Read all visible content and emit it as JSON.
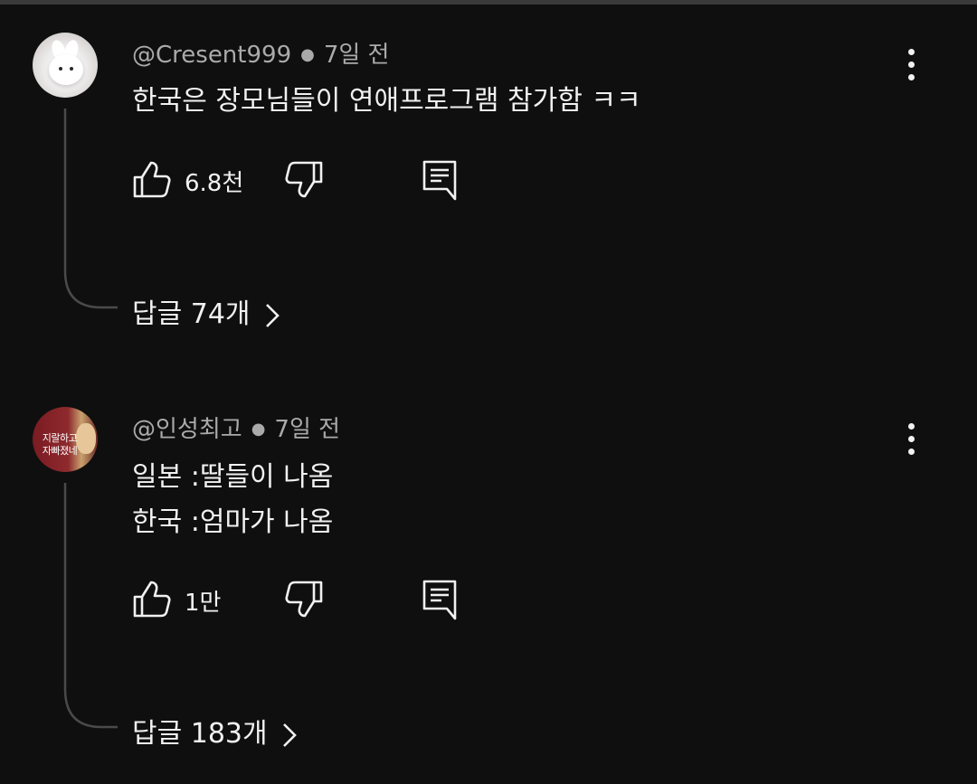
{
  "comments": [
    {
      "author": "@Cresent999",
      "time": "7일 전",
      "text_lines": [
        "한국은 장모님들이 연애프로그램 참가함 ㅋㅋ"
      ],
      "likes": "6.8천",
      "replies_label": "답글 74개"
    },
    {
      "author": "@인성최고",
      "time": "7일 전",
      "avatar_text": [
        "지랄하고",
        "자빠졌네"
      ],
      "text_lines": [
        "일본 :딸들이 나옴",
        "한국 :엄마가 나옴"
      ],
      "likes": "1만",
      "replies_label": "답글 183개"
    }
  ],
  "icons": {
    "like": "thumbs-up-icon",
    "dislike": "thumbs-down-icon",
    "reply": "comment-reply-icon",
    "more": "more-vert-icon",
    "chevron": "chevron-right-icon"
  },
  "colors": {
    "background": "#0f0f0f",
    "text": "#f1f1f1",
    "meta": "#aaaaaa",
    "thread_line": "#4a4a4a"
  }
}
